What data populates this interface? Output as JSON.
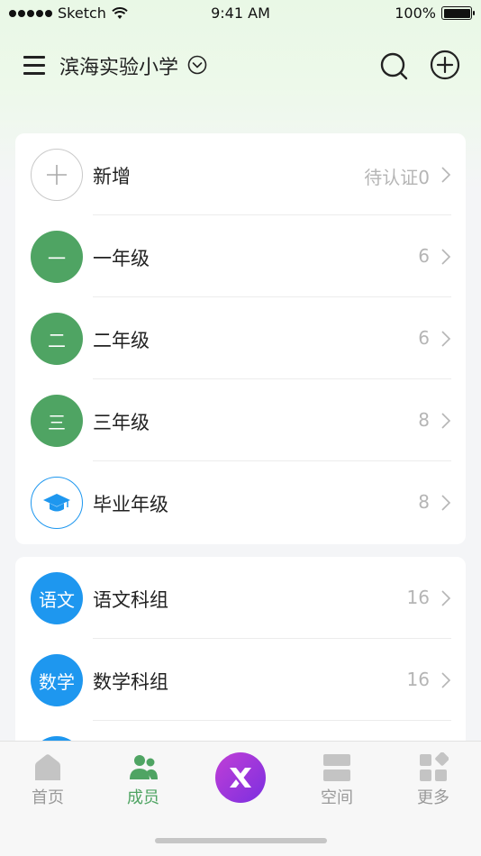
{
  "status_bar": {
    "carrier": "Sketch",
    "time": "9:41 AM",
    "battery": "100%"
  },
  "header": {
    "school_name": "滨海实验小学"
  },
  "groups": [
    {
      "label": "新增",
      "avatar": "",
      "count": "待认证0",
      "style": "outline-gray",
      "icon": "plus-icon"
    },
    {
      "label": "一年级",
      "avatar": "一",
      "count": "6",
      "style": "green"
    },
    {
      "label": "二年级",
      "avatar": "二",
      "count": "6",
      "style": "green"
    },
    {
      "label": "三年级",
      "avatar": "三",
      "count": "8",
      "style": "green"
    },
    {
      "label": "毕业年级",
      "avatar": "",
      "count": "8",
      "style": "outline-blue",
      "icon": "graduation-cap-icon"
    }
  ],
  "subjects": [
    {
      "label": "语文科组",
      "avatar": "语文",
      "count": "16",
      "style": "blue"
    },
    {
      "label": "数学科组",
      "avatar": "数学",
      "count": "16",
      "style": "blue"
    }
  ],
  "tabbar": {
    "home": "首页",
    "members": "成员",
    "space": "空间",
    "more": "更多"
  },
  "colors": {
    "green": "#4fa463",
    "blue": "#1e97ef",
    "purple": "#9b35dc"
  }
}
